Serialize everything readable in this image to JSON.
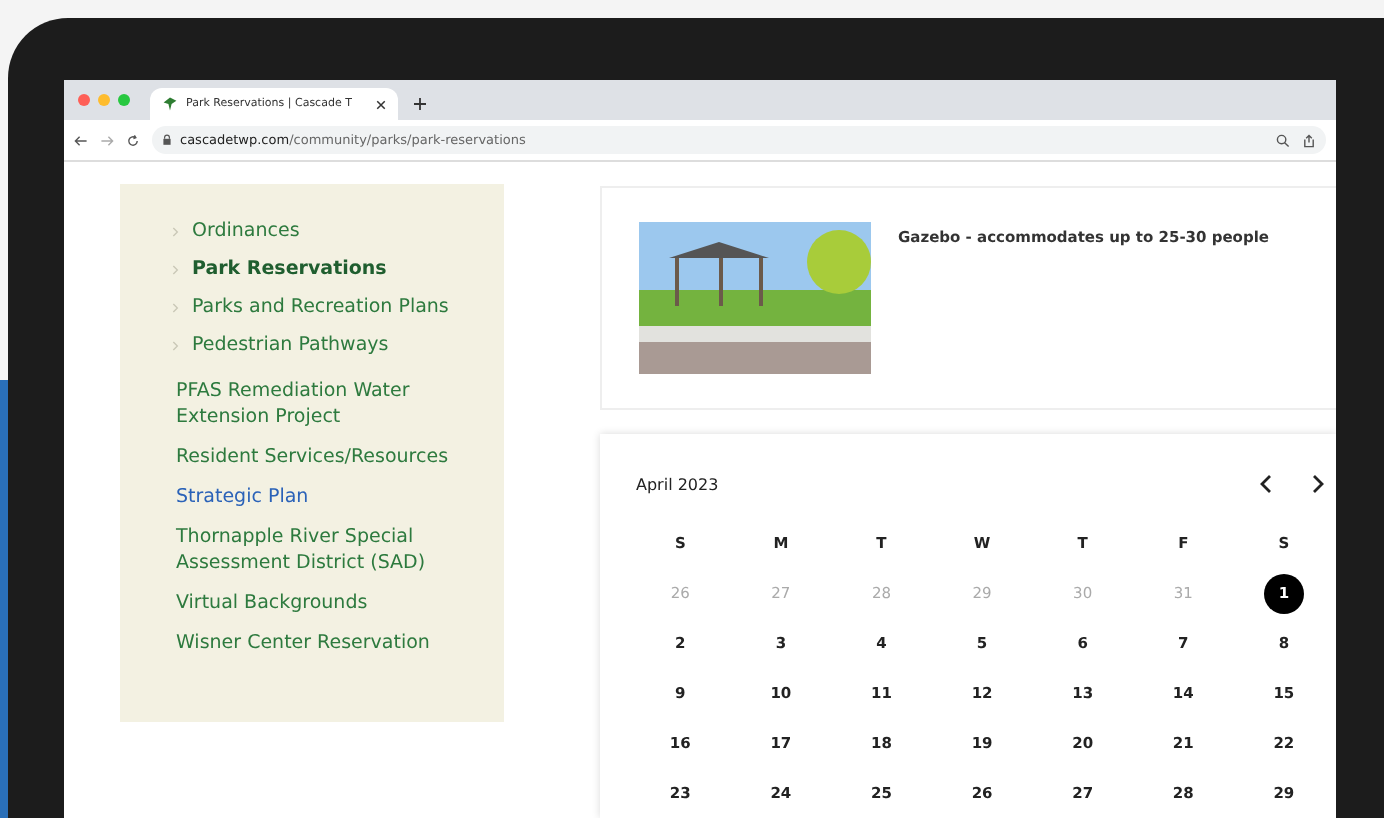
{
  "browser": {
    "tab_title": "Park Reservations | Cascade T",
    "url_host": "cascadetwp.com",
    "url_path": "/community/parks/park-reservations"
  },
  "sidebar": {
    "items": [
      {
        "label": "Ordinances",
        "kind": "sub",
        "selected": false,
        "visited": false
      },
      {
        "label": "Park Reservations",
        "kind": "sub",
        "selected": true,
        "visited": false
      },
      {
        "label": "Parks and Recreation Plans",
        "kind": "sub",
        "selected": false,
        "visited": false
      },
      {
        "label": "Pedestrian Pathways",
        "kind": "sub",
        "selected": false,
        "visited": false
      },
      {
        "label": "PFAS Remediation Water Extension Project",
        "kind": "top",
        "selected": false,
        "visited": false
      },
      {
        "label": "Resident Services/Resources",
        "kind": "top",
        "selected": false,
        "visited": false
      },
      {
        "label": "Strategic Plan",
        "kind": "top",
        "selected": false,
        "visited": true
      },
      {
        "label": "Thornapple River Special Assessment District (SAD)",
        "kind": "top",
        "selected": false,
        "visited": false
      },
      {
        "label": "Virtual Backgrounds",
        "kind": "top",
        "selected": false,
        "visited": false
      },
      {
        "label": "Wisner Center Reservation",
        "kind": "top",
        "selected": false,
        "visited": false
      }
    ]
  },
  "facility": {
    "caption": "Gazebo - accommodates up to 25-30 people"
  },
  "calendar": {
    "month": "April 2023",
    "weekdays": [
      "S",
      "M",
      "T",
      "W",
      "T",
      "F",
      "S"
    ],
    "days": [
      {
        "label": "26",
        "muted": true,
        "selected": false
      },
      {
        "label": "27",
        "muted": true,
        "selected": false
      },
      {
        "label": "28",
        "muted": true,
        "selected": false
      },
      {
        "label": "29",
        "muted": true,
        "selected": false
      },
      {
        "label": "30",
        "muted": true,
        "selected": false
      },
      {
        "label": "31",
        "muted": true,
        "selected": false
      },
      {
        "label": "1",
        "muted": false,
        "selected": true
      },
      {
        "label": "2",
        "muted": false,
        "selected": false
      },
      {
        "label": "3",
        "muted": false,
        "selected": false
      },
      {
        "label": "4",
        "muted": false,
        "selected": false
      },
      {
        "label": "5",
        "muted": false,
        "selected": false
      },
      {
        "label": "6",
        "muted": false,
        "selected": false
      },
      {
        "label": "7",
        "muted": false,
        "selected": false
      },
      {
        "label": "8",
        "muted": false,
        "selected": false
      },
      {
        "label": "9",
        "muted": false,
        "selected": false
      },
      {
        "label": "10",
        "muted": false,
        "selected": false
      },
      {
        "label": "11",
        "muted": false,
        "selected": false
      },
      {
        "label": "12",
        "muted": false,
        "selected": false
      },
      {
        "label": "13",
        "muted": false,
        "selected": false
      },
      {
        "label": "14",
        "muted": false,
        "selected": false
      },
      {
        "label": "15",
        "muted": false,
        "selected": false
      },
      {
        "label": "16",
        "muted": false,
        "selected": false
      },
      {
        "label": "17",
        "muted": false,
        "selected": false
      },
      {
        "label": "18",
        "muted": false,
        "selected": false
      },
      {
        "label": "19",
        "muted": false,
        "selected": false
      },
      {
        "label": "20",
        "muted": false,
        "selected": false
      },
      {
        "label": "21",
        "muted": false,
        "selected": false
      },
      {
        "label": "22",
        "muted": false,
        "selected": false
      },
      {
        "label": "23",
        "muted": false,
        "selected": false
      },
      {
        "label": "24",
        "muted": false,
        "selected": false
      },
      {
        "label": "25",
        "muted": false,
        "selected": false
      },
      {
        "label": "26",
        "muted": false,
        "selected": false
      },
      {
        "label": "27",
        "muted": false,
        "selected": false
      },
      {
        "label": "28",
        "muted": false,
        "selected": false
      },
      {
        "label": "29",
        "muted": false,
        "selected": false
      }
    ]
  }
}
